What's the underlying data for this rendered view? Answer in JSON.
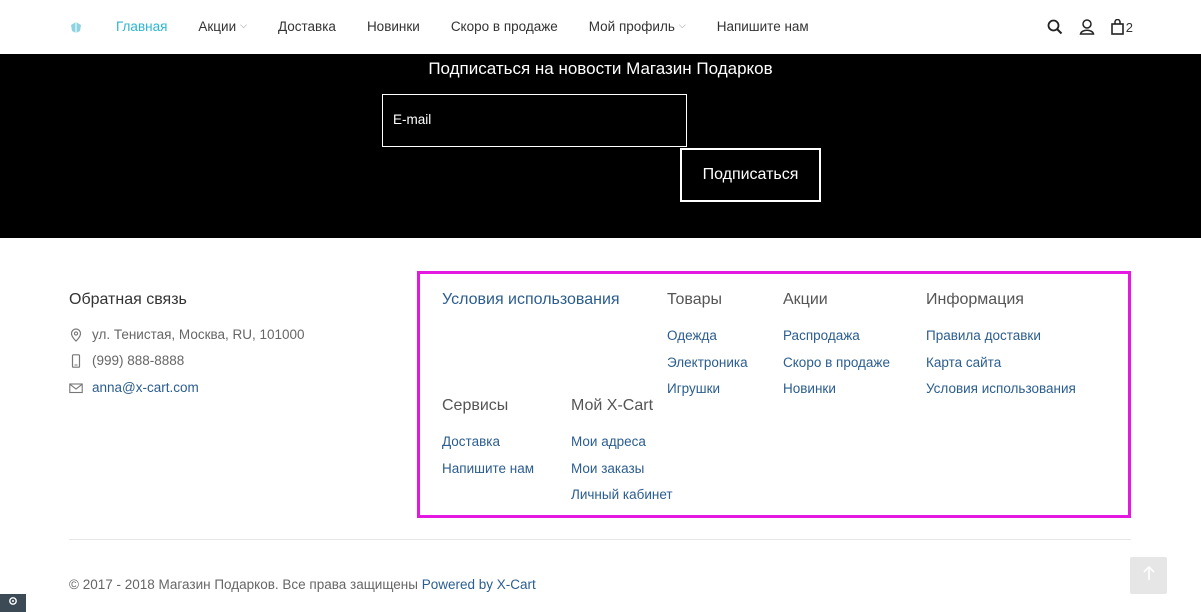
{
  "nav": {
    "items": [
      {
        "label": "Главная",
        "active": true,
        "dropdown": false
      },
      {
        "label": "Акции",
        "active": false,
        "dropdown": true
      },
      {
        "label": "Доставка",
        "active": false,
        "dropdown": false
      },
      {
        "label": "Новинки",
        "active": false,
        "dropdown": false
      },
      {
        "label": "Скоро в продаже",
        "active": false,
        "dropdown": false
      },
      {
        "label": "Мой профиль",
        "active": false,
        "dropdown": true
      },
      {
        "label": "Напишите нам",
        "active": false,
        "dropdown": false
      }
    ],
    "icons": [
      "search-icon",
      "user-icon",
      "cart-icon"
    ],
    "cart_count": "2"
  },
  "subscribe": {
    "title": "Подписаться на новости Магазин Подарков",
    "email_placeholder": "E-mail",
    "button_label": "Подписаться"
  },
  "contacts": {
    "title": "Обратная связь",
    "address": "ул. Тенистая, Москва, RU, 101000",
    "phone": "(999) 888-8888",
    "email": "anna@x-cart.com"
  },
  "footer_links": {
    "terms": {
      "title": "Условия использования"
    },
    "goods": {
      "title": "Товары",
      "items": [
        "Одежда",
        "Электроника",
        "Игрушки"
      ]
    },
    "promos": {
      "title": "Акции",
      "items": [
        "Распродажа",
        "Скоро в продаже",
        "Новинки"
      ]
    },
    "info": {
      "title": "Информация",
      "items": [
        "Правила доставки",
        "Карта сайта",
        "Условия использования"
      ]
    },
    "services": {
      "title": "Сервисы",
      "items": [
        "Доставка",
        "Напишите нам"
      ]
    },
    "myxcart": {
      "title": "Мой X-Cart",
      "items": [
        "Мои адреса",
        "Мои заказы",
        "Личный кабинет"
      ]
    }
  },
  "copyright": {
    "text": "© 2017 - 2018 Магазин Подарков. Все права защищены",
    "powered": "Powered by X-Cart"
  },
  "colors": {
    "accent": "#2bb7d1",
    "link": "#2b5d8f",
    "highlight_border": "#e418e0",
    "band_bg": "#000000"
  }
}
